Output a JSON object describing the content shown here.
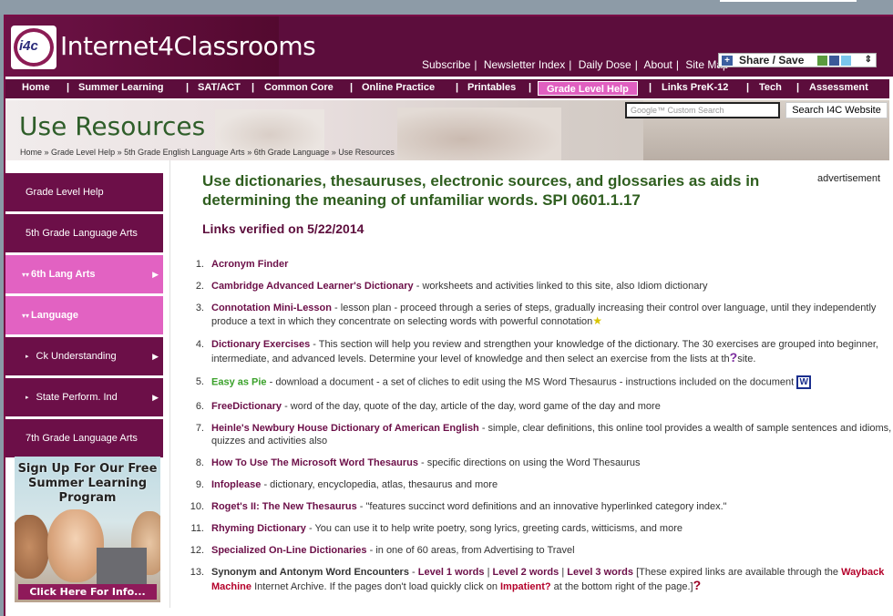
{
  "site": {
    "name": "Internet4Classrooms",
    "logo_text": "i4c"
  },
  "toplinks": [
    "Subscribe",
    "Newsletter Index",
    "Daily Dose",
    "About",
    "Site Map"
  ],
  "share_label": "Share / Save",
  "nav": [
    "Home",
    "Summer Learning",
    "SAT/ACT",
    "Common Core",
    "Online Practice",
    "Printables",
    "Grade Level Help",
    "Links PreK-12",
    "Tech",
    "Assessment"
  ],
  "nav_active": "Grade Level Help",
  "banner": {
    "title": "Use Resources",
    "search_placeholder": "Google™ Custom Search",
    "search_button": "Search I4C Website",
    "breadcrumb": [
      "Home",
      "Grade Level Help",
      "5th Grade English Language Arts",
      "6th Grade Language",
      "Use Resources"
    ]
  },
  "sidebar": [
    {
      "label": "Grade Level Help",
      "style": "dark"
    },
    {
      "label": "5th Grade Language Arts",
      "style": "dark"
    },
    {
      "label": "6th Lang Arts",
      "style": "pink"
    },
    {
      "label": "Language",
      "style": "pink"
    },
    {
      "label": "Ck Understanding",
      "style": "dark"
    },
    {
      "label": "State Perform. Ind",
      "style": "dark"
    },
    {
      "label": "7th Grade Language Arts",
      "style": "dark"
    }
  ],
  "promo": {
    "text": "Sign Up For Our Free Summer Learning Program",
    "cta": "Click Here For Info..."
  },
  "main": {
    "title": "Use dictionaries, thesauruses, electronic sources, and glossaries as aids in determining the meaning of unfamiliar words. SPI 0601.1.17",
    "verified": "Links verified on 5/22/2014",
    "advertisement": "advertisement"
  },
  "items": [
    {
      "num": "1.",
      "link": "Acronym Finder",
      "desc": ""
    },
    {
      "num": "2.",
      "link": "Cambridge Advanced Learner's Dictionary",
      "desc": " - worksheets and activities linked to this site, also Idiom dictionary"
    },
    {
      "num": "3.",
      "link": "Connotation Mini-Lesson",
      "desc": " - lesson plan - proceed through a series of steps, gradually increasing their control over language, until they independently produce a text in which they concentrate on selecting words with powerful connotation"
    },
    {
      "num": "4.",
      "link": "Dictionary Exercises",
      "desc": " - This section will help you review and strengthen your knowledge of the dictionary. The 30 exercises are grouped into beginner, intermediate, and advanced levels. Determine your level of knowledge and then select an exercise from the lists at th",
      "desc_end": "site."
    },
    {
      "num": "5.",
      "link": "Easy as Pie",
      "desc": " - download a document - a set of cliches to edit using the MS Word Thesaurus - instructions included on the document"
    },
    {
      "num": "6.",
      "link": "FreeDictionary",
      "desc": " - word of the day, quote of the day, article of the day, word game of the day and more"
    },
    {
      "num": "7.",
      "link": "Heinle's Newbury House Dictionary of American English",
      "desc": " - simple, clear definitions, this online tool provides a wealth of sample sentences and idioms, quizzes and activities also"
    },
    {
      "num": "8.",
      "link": "How To Use The Microsoft Word Thesaurus",
      "desc": " - specific directions on using the Word Thesaurus"
    },
    {
      "num": "9.",
      "link": "Infoplease",
      "desc": " - dictionary, encyclopedia, atlas, thesaurus and more"
    },
    {
      "num": "10.",
      "link": "Roget's II: The New Thesaurus",
      "desc": " - \"features succinct word definitions and an innovative hyperlinked category index.\""
    },
    {
      "num": "11.",
      "link": "Rhyming Dictionary",
      "desc": " - You can use it to help write poetry, song lyrics, greeting cards, witticisms, and more"
    },
    {
      "num": "12.",
      "link": "Specialized On-Line Dictionaries",
      "desc": " - in one of 60 areas, from Advertising to Travel"
    },
    {
      "num": "13.",
      "link": "Synonym and Antonym Word Encounters",
      "desc": " - ",
      "level1": "Level 1 words",
      "level2": "Level 2 words",
      "level3": "Level 3 words",
      "note": " [These expired links are available through the ",
      "wayback": "Wayback Machine",
      "note2": " Internet Archive. If the pages don't load quickly click on ",
      "impatient": "Impatient?",
      "note3": " at the bottom right of the page.]"
    }
  ],
  "icons": {
    "star": "star-icon",
    "question": "help-icon",
    "word": "word-doc-icon"
  }
}
